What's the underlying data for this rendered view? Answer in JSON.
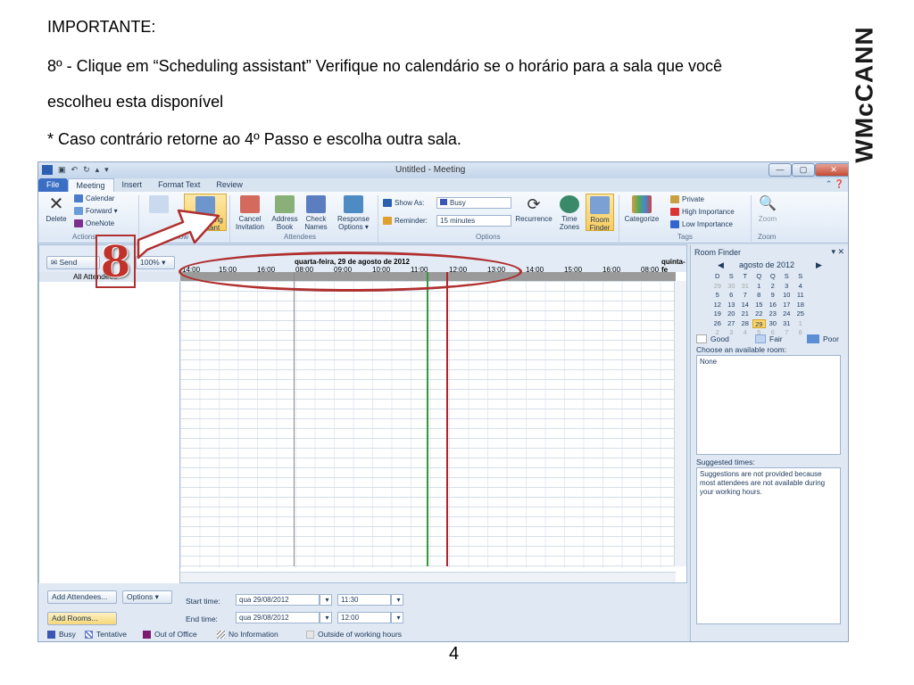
{
  "slide": {
    "heading": "IMPORTANTE:",
    "line1": "8º - Clique em “Scheduling assistant” Verifique no calendário se o horário para a sala que você",
    "line2": "escolheu esta disponível",
    "line3": "* Caso contrário retorne ao 4º Passo e escolha outra sala.",
    "logo": "WMcCANN",
    "page_number": "4",
    "step_badge": "8"
  },
  "window": {
    "title": "Untitled - Meeting",
    "min": "—",
    "max": "▢",
    "close": "✕"
  },
  "tabs": [
    "File",
    "Meeting",
    "Insert",
    "Format Text",
    "Review"
  ],
  "ribbon": {
    "delete": "Delete",
    "calendar": "Calendar",
    "forward": "Forward ▾",
    "onenote": "OneNote",
    "actions": "Actions",
    "show": "Show",
    "scheduling": "Scheduling Assistant",
    "cancel": "Cancel Invitation",
    "address": "Address Book",
    "check": "Check Names",
    "response": "Response Options ▾",
    "attendees": "Attendees",
    "show_as_label": "Show As:",
    "show_as_value": "Busy",
    "reminder_label": "Reminder:",
    "reminder_value": "15 minutes",
    "recurrence": "Recurrence",
    "time_zones": "Time Zones",
    "room_finder": "Room Finder",
    "options": "Options",
    "categorize": "Categorize",
    "private": "Private",
    "high": "High Importance",
    "low": "Low Importance",
    "tags": "Tags",
    "zoom": "Zoom",
    "zoom_group": "Zoom"
  },
  "scheduler": {
    "send": "Send",
    "zoom_value": "100%",
    "day1": "quarta-feira, 29 de agosto de 2012",
    "day2": "quinta-fe",
    "hours": [
      "14:00",
      "15:00",
      "16:00",
      "08:00",
      "09:00",
      "10:00",
      "11:00",
      "12:00",
      "13:00",
      "14:00",
      "15:00",
      "16:00",
      "08:00"
    ],
    "all_attendees": "All Attendees",
    "add_attendees": "Add Attendees...",
    "options_btn": "Options ▾",
    "add_rooms": "Add Rooms...",
    "start_label": "Start time:",
    "start_date": "qua 29/08/2012",
    "start_time": "11:30",
    "end_label": "End time:",
    "end_date": "qua 29/08/2012",
    "end_time": "12:00"
  },
  "legend": {
    "busy": "Busy",
    "tentative": "Tentative",
    "ooo": "Out of Office",
    "noinfo": "No Information",
    "outside": "Outside of working hours"
  },
  "room_finder": {
    "title": "Room Finder",
    "month": "agosto de 2012",
    "weekdays": [
      "D",
      "S",
      "T",
      "Q",
      "Q",
      "S",
      "S"
    ],
    "weeks": [
      [
        "29",
        "30",
        "31",
        "1",
        "2",
        "3",
        "4"
      ],
      [
        "5",
        "6",
        "7",
        "8",
        "9",
        "10",
        "11"
      ],
      [
        "12",
        "13",
        "14",
        "15",
        "16",
        "17",
        "18"
      ],
      [
        "19",
        "20",
        "21",
        "22",
        "23",
        "24",
        "25"
      ],
      [
        "26",
        "27",
        "28",
        "29",
        "30",
        "31",
        "1"
      ],
      [
        "2",
        "3",
        "4",
        "5",
        "6",
        "7",
        "8"
      ]
    ],
    "good": "Good",
    "fair": "Fair",
    "poor": "Poor",
    "choose": "Choose an available room:",
    "room_value": "None",
    "suggested": "Suggested times:",
    "suggest_text": "Suggestions are not provided because most attendees are not available during your working hours."
  },
  "colors": {
    "busy": "#3b57b5",
    "ooo": "#7b1a6e",
    "accent": "#3a6fc4",
    "annotation": "#b03030"
  }
}
